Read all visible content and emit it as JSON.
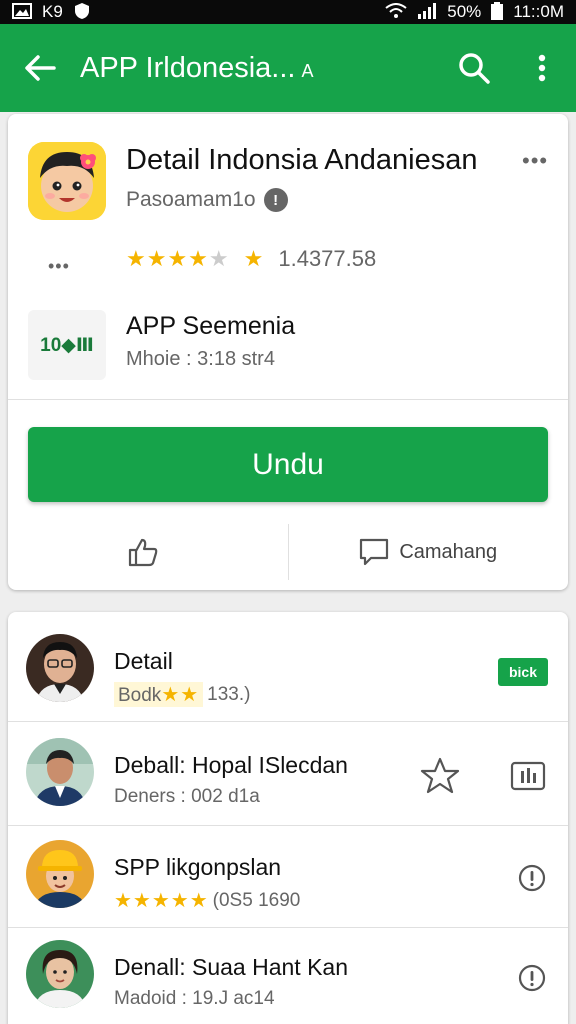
{
  "status_bar": {
    "left_icons": [
      "gallery-icon",
      "notification-icon",
      "shield-icon"
    ],
    "left_label": "K9",
    "battery": "50%",
    "time": "11::0M"
  },
  "app_bar": {
    "title": "APP Irldonesia...",
    "caret": "A"
  },
  "app": {
    "name": "Detail Indonsia Andaniesan",
    "developer": "Pasoamam1o",
    "rating_stars": "★★★★",
    "rating_half": "★",
    "rating_value_star": "★",
    "rating_value": "1.4377.58",
    "more_dots": "•••"
  },
  "secondary": {
    "icon_text": "10◆Ⅲ",
    "name": "APP Seemenia",
    "meta": "Mhoie : 3:18 str4"
  },
  "install_button": "Undu",
  "actions": {
    "like_label": "",
    "comment_label": "Camahang"
  },
  "list": [
    {
      "title": "Detail",
      "sub_prefix": "Bodk",
      "sub_stars": "★★",
      "sub_suffix": "133.)",
      "tag": "bick"
    },
    {
      "title": "Deball: Hopal ISlecdan",
      "sub": "Deners : 002 d1a"
    },
    {
      "title": "SPP likgonpslan",
      "sub_stars": "★★★★★",
      "sub_suffix": "(0S5 1690"
    },
    {
      "title": "Denall: Suaa Hant Kan",
      "sub": "Madoid : 19.J ac14"
    }
  ],
  "colors": {
    "primary": "#16a34a",
    "star": "#f5b400",
    "status_bar": "#0a0a0a"
  }
}
